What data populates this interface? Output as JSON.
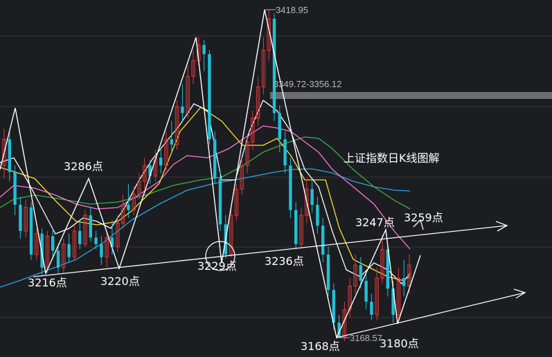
{
  "title": "上证指数日K线图解",
  "colors": {
    "background": "#1c1d21",
    "up": "#e03a3a",
    "down": "#21c0d6",
    "ma5": "#ffffff",
    "ma10": "#ffe033",
    "ma20": "#ff78dc",
    "ma30": "#3cb04a",
    "ma60": "#2aa7e6",
    "annotation": "#ffffff"
  },
  "chart_data": {
    "type": "candlestick",
    "price_labels": {
      "high": "3418.95",
      "zone": "3349.72-3356.12",
      "low": "3168.57"
    },
    "pivots": [
      {
        "label": "3286点",
        "price": 3286
      },
      {
        "label": "3216点",
        "price": 3216
      },
      {
        "label": "3220点",
        "price": 3220
      },
      {
        "label": "3229点",
        "price": 3229
      },
      {
        "label": "3236点",
        "price": 3236
      },
      {
        "label": "3247点",
        "price": 3247
      },
      {
        "label": "3259点",
        "price": 3259
      },
      {
        "label": "3168点",
        "price": 3168
      },
      {
        "label": "3180点",
        "price": 3180
      }
    ],
    "candles": [
      [
        3300,
        3320,
        3290,
        3328
      ],
      [
        3320,
        3295,
        3288,
        3326
      ],
      [
        3295,
        3270,
        3262,
        3300
      ],
      [
        3270,
        3250,
        3244,
        3276
      ],
      [
        3250,
        3268,
        3245,
        3274
      ],
      [
        3268,
        3232,
        3228,
        3272
      ],
      [
        3232,
        3248,
        3228,
        3252
      ],
      [
        3248,
        3222,
        3216,
        3252
      ],
      [
        3222,
        3246,
        3218,
        3250
      ],
      [
        3246,
        3235,
        3230,
        3252
      ],
      [
        3235,
        3222,
        3217,
        3240
      ],
      [
        3222,
        3240,
        3218,
        3244
      ],
      [
        3240,
        3230,
        3226,
        3248
      ],
      [
        3230,
        3250,
        3228,
        3254
      ],
      [
        3250,
        3240,
        3236,
        3258
      ],
      [
        3240,
        3262,
        3238,
        3266
      ],
      [
        3262,
        3245,
        3242,
        3268
      ],
      [
        3245,
        3240,
        3236,
        3250
      ],
      [
        3240,
        3230,
        3224,
        3246
      ],
      [
        3230,
        3245,
        3222,
        3248
      ],
      [
        3245,
        3238,
        3232,
        3258
      ],
      [
        3238,
        3256,
        3234,
        3262
      ],
      [
        3256,
        3270,
        3252,
        3278
      ],
      [
        3270,
        3266,
        3260,
        3286
      ],
      [
        3266,
        3278,
        3262,
        3284
      ],
      [
        3278,
        3288,
        3274,
        3294
      ],
      [
        3288,
        3300,
        3282,
        3306
      ],
      [
        3300,
        3292,
        3286,
        3304
      ],
      [
        3292,
        3306,
        3288,
        3312
      ],
      [
        3306,
        3300,
        3294,
        3314
      ],
      [
        3300,
        3320,
        3296,
        3326
      ],
      [
        3320,
        3316,
        3310,
        3334
      ],
      [
        3316,
        3345,
        3312,
        3350
      ],
      [
        3345,
        3340,
        3334,
        3362
      ],
      [
        3340,
        3368,
        3336,
        3376
      ],
      [
        3368,
        3380,
        3362,
        3388
      ],
      [
        3380,
        3392,
        3376,
        3398
      ],
      [
        3392,
        3385,
        3372,
        3396
      ],
      [
        3385,
        3320,
        3316,
        3388
      ],
      [
        3320,
        3290,
        3286,
        3326
      ],
      [
        3290,
        3255,
        3250,
        3296
      ],
      [
        3255,
        3232,
        3229,
        3262
      ],
      [
        3232,
        3262,
        3230,
        3268
      ],
      [
        3262,
        3282,
        3258,
        3286
      ],
      [
        3282,
        3300,
        3278,
        3306
      ],
      [
        3300,
        3318,
        3294,
        3324
      ],
      [
        3318,
        3336,
        3312,
        3342
      ],
      [
        3336,
        3360,
        3330,
        3368
      ],
      [
        3360,
        3388,
        3354,
        3398
      ],
      [
        3388,
        3412,
        3380,
        3419
      ],
      [
        3412,
        3340,
        3334,
        3416
      ],
      [
        3340,
        3320,
        3310,
        3346
      ],
      [
        3320,
        3300,
        3294,
        3326
      ],
      [
        3300,
        3266,
        3260,
        3306
      ],
      [
        3266,
        3240,
        3236,
        3272
      ],
      [
        3240,
        3262,
        3238,
        3268
      ],
      [
        3262,
        3282,
        3256,
        3290
      ],
      [
        3282,
        3270,
        3264,
        3288
      ],
      [
        3270,
        3254,
        3248,
        3276
      ],
      [
        3254,
        3232,
        3226,
        3260
      ],
      [
        3232,
        3205,
        3200,
        3238
      ],
      [
        3205,
        3180,
        3175,
        3210
      ],
      [
        3180,
        3168.6,
        3168.57,
        3186
      ],
      [
        3168.6,
        3190,
        3166,
        3196
      ],
      [
        3190,
        3208,
        3184,
        3214
      ],
      [
        3208,
        3224,
        3202,
        3232
      ],
      [
        3224,
        3212,
        3206,
        3230
      ],
      [
        3212,
        3196,
        3190,
        3218
      ],
      [
        3196,
        3186,
        3182,
        3202
      ],
      [
        3186,
        3214,
        3182,
        3222
      ],
      [
        3214,
        3236,
        3210,
        3247
      ],
      [
        3236,
        3206,
        3200,
        3240
      ],
      [
        3206,
        3186,
        3180,
        3212
      ],
      [
        3186,
        3214,
        3182,
        3222
      ],
      [
        3214,
        3208,
        3200,
        3228
      ],
      [
        3208,
        3224,
        3202,
        3232
      ]
    ]
  }
}
